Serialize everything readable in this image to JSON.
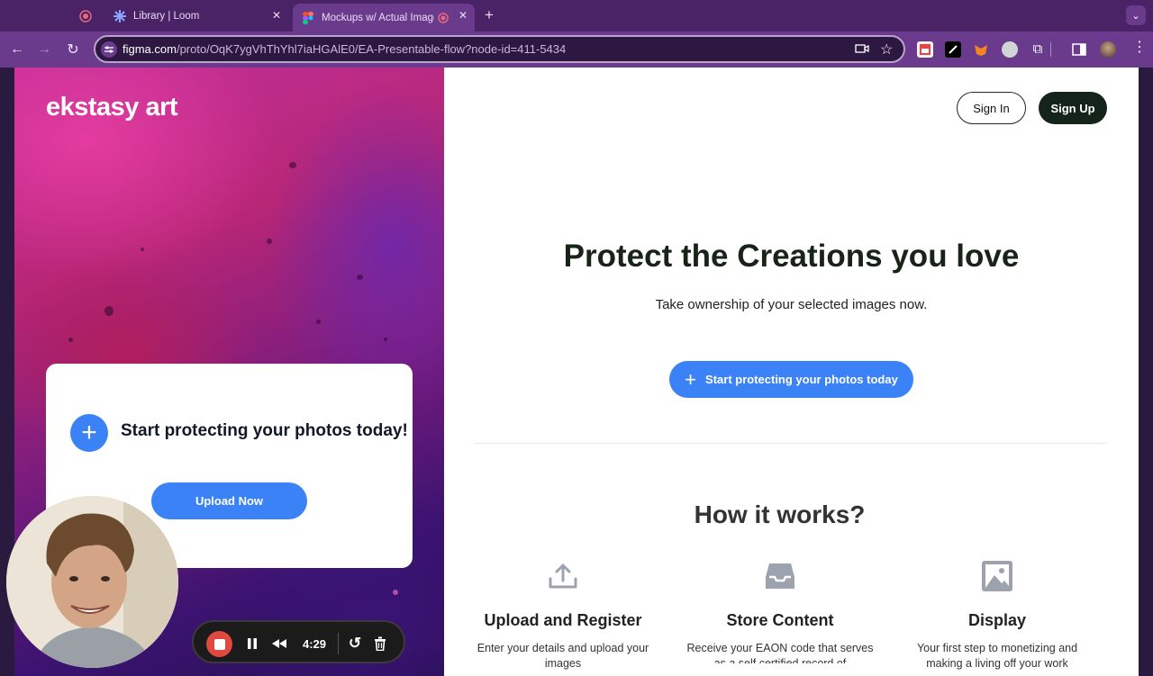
{
  "browser": {
    "tabs": [
      {
        "label": ""
      },
      {
        "label": "Library | Loom"
      },
      {
        "label": "Mockups w/ Actual Image"
      }
    ],
    "url": {
      "host": "figma.com",
      "path": "/proto/OqK7ygVhThYhl7iaHGAlE0/EA-Presentable-flow?node-id=411-5434"
    }
  },
  "left": {
    "logo": "ekstasy art",
    "card": {
      "title": "Start protecting your photos today!",
      "button": "Upload Now"
    }
  },
  "header": {
    "sign_in": "Sign In",
    "sign_up": "Sign Up"
  },
  "hero": {
    "title": "Protect the Creations you love",
    "subtitle": "Take ownership of your selected images now.",
    "button": "Start protecting your photos today"
  },
  "how": {
    "title": "How it works?",
    "steps": [
      {
        "title": "Upload and Register",
        "desc": "Enter your details and upload your images",
        "icon": "upload-icon"
      },
      {
        "title": "Store Content",
        "desc": "Receive your EAON code that serves as a self certified record of",
        "icon": "inbox-icon"
      },
      {
        "title": "Display",
        "desc": "Your first step to monetizing and making a living off your work",
        "icon": "image-icon"
      }
    ]
  },
  "loom": {
    "timer": "4:29"
  },
  "colors": {
    "accent": "#3b82f6",
    "dark_green": "#15241a",
    "loom_red": "#e0493f"
  }
}
